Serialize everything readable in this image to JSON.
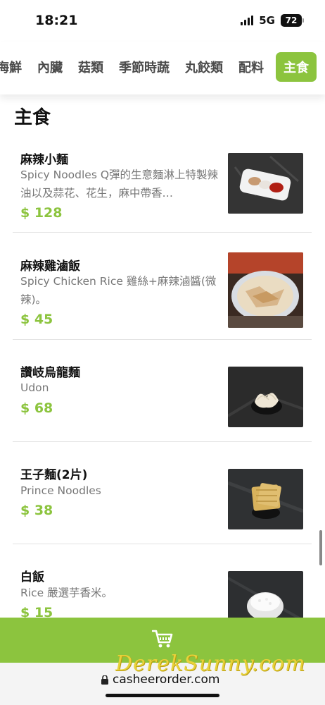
{
  "status": {
    "time": "18:21",
    "network": "5G",
    "battery": "72"
  },
  "tabs": [
    {
      "label": "海鮮",
      "active": false
    },
    {
      "label": "內臟",
      "active": false
    },
    {
      "label": "菇類",
      "active": false
    },
    {
      "label": "季節時蔬",
      "active": false
    },
    {
      "label": "丸餃類",
      "active": false
    },
    {
      "label": "配料",
      "active": false
    },
    {
      "label": "主食",
      "active": true
    }
  ],
  "section": {
    "title": "主食"
  },
  "items": [
    {
      "name": "麻辣小麵",
      "desc": "Spicy Noodles Q彈的生意麵淋上特製辣油以及蒜花、花生，麻中帶香…",
      "price": "$ 128"
    },
    {
      "name": "麻辣雞滷飯",
      "desc": "Spicy Chicken Rice 雞絲+麻辣滷醬(微辣)。",
      "price": "$ 45"
    },
    {
      "name": "讚岐烏龍麵",
      "desc": "Udon",
      "price": "$ 68"
    },
    {
      "name": "王子麵(2片)",
      "desc": "Prince Noodles",
      "price": "$ 38"
    },
    {
      "name": "白飯",
      "desc": "Rice 嚴選芋香米。",
      "price": "$ 15"
    }
  ],
  "cart": {
    "icon": "cart-icon"
  },
  "browser": {
    "url": "casheerorder.com"
  },
  "watermark": "DerekSunny.com",
  "colors": {
    "accent": "#8cc43e",
    "muted_text": "#777777"
  }
}
